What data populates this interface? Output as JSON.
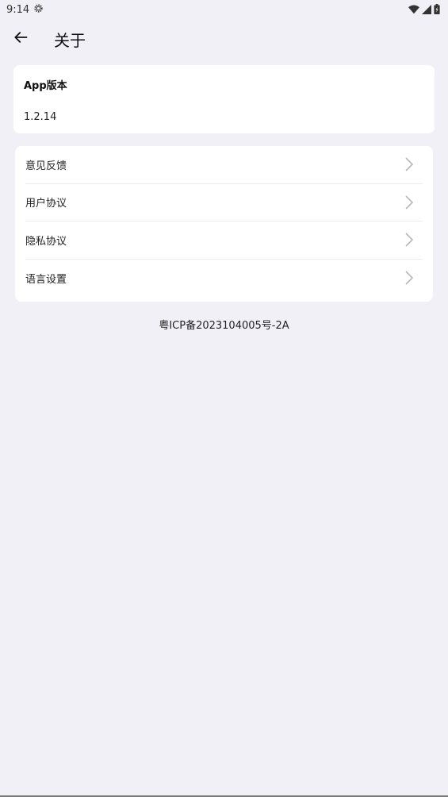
{
  "status_bar": {
    "time": "9:14",
    "icons": [
      "settings-icon",
      "wifi-icon",
      "signal-icon",
      "battery-icon"
    ]
  },
  "header": {
    "title": "关于",
    "back_icon": "arrow-left-icon"
  },
  "version": {
    "label": "App版本",
    "value": "1.2.14"
  },
  "menu": {
    "items": [
      {
        "label": "意见反馈"
      },
      {
        "label": "用户协议"
      },
      {
        "label": "隐私协议"
      },
      {
        "label": "语言设置"
      }
    ]
  },
  "footer": {
    "icp": "粤ICP备2023104005号-2A"
  },
  "colors": {
    "background": "#f1f0f6",
    "card": "#ffffff",
    "chevron": "#b8b8b8"
  }
}
